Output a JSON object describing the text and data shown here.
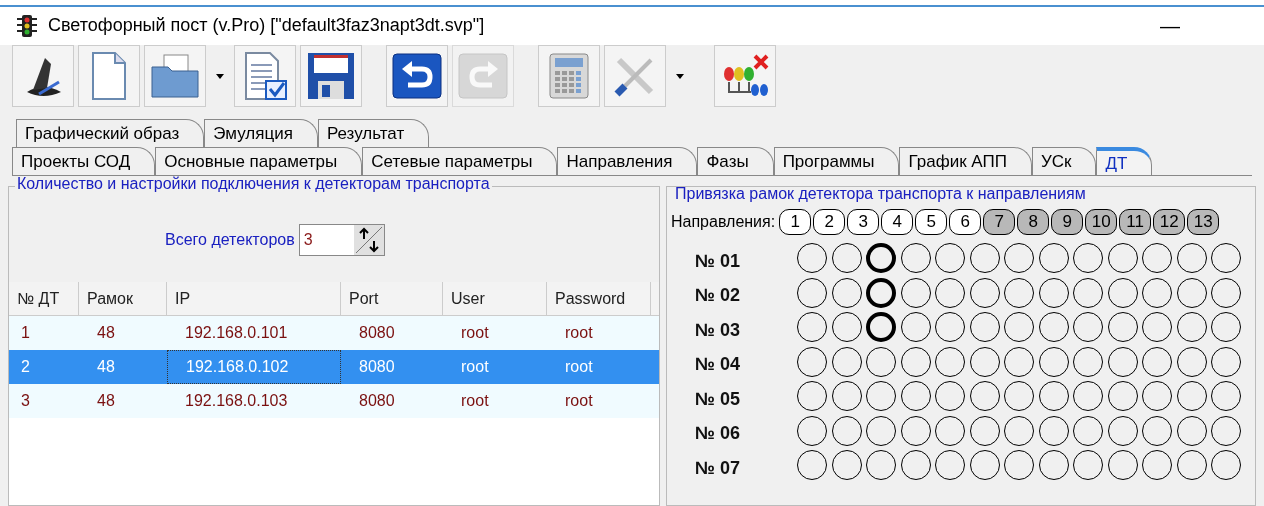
{
  "window": {
    "title": "Светофорный пост (v.Pro) [\"default3faz3napt3dt.svp\"]",
    "minimize": "—"
  },
  "toolbar": [
    {
      "kind": "wizard",
      "disabled": false
    },
    {
      "kind": "new",
      "disabled": false
    },
    {
      "kind": "open",
      "disabled": false,
      "dropdown": true
    },
    {
      "kind": "checklist",
      "disabled": false
    },
    {
      "kind": "save",
      "disabled": false
    },
    {
      "kind": "undo",
      "disabled": false
    },
    {
      "kind": "redo",
      "disabled": true
    },
    {
      "kind": "calculator",
      "disabled": false
    },
    {
      "kind": "tools",
      "disabled": false,
      "dropdown": true
    },
    {
      "kind": "lights",
      "disabled": false
    }
  ],
  "tabs_back": [
    {
      "label": "Графический образ",
      "selected": false
    },
    {
      "label": "Эмуляция",
      "selected": false
    },
    {
      "label": "Результат",
      "selected": false
    }
  ],
  "tabs": [
    {
      "label": "Проекты СОД",
      "selected": false
    },
    {
      "label": "Основные параметры",
      "selected": false
    },
    {
      "label": "Сетевые параметры",
      "selected": false
    },
    {
      "label": "Направления",
      "selected": false
    },
    {
      "label": "Фазы",
      "selected": false
    },
    {
      "label": "Программы",
      "selected": false
    },
    {
      "label": "График АПП",
      "selected": false
    },
    {
      "label": "УСк",
      "selected": false
    },
    {
      "label": "ДТ",
      "selected": true
    }
  ],
  "detectors": {
    "title": "Количество и настройки подключения к детекторам транспорта",
    "count_label": "Всего детекторов",
    "count_value": "3",
    "columns": [
      "№ ДТ",
      "Рамок",
      "IP",
      "Port",
      "User",
      "Password"
    ],
    "rows": [
      {
        "cells": [
          "1",
          "48",
          "192.168.0.101",
          "8080",
          "root",
          "root"
        ],
        "selected": false
      },
      {
        "cells": [
          "2",
          "48",
          "192.168.0.102",
          "8080",
          "root",
          "root"
        ],
        "selected": true
      },
      {
        "cells": [
          "3",
          "48",
          "192.168.0.103",
          "8080",
          "root",
          "root"
        ],
        "selected": false
      }
    ]
  },
  "binding": {
    "title": "Привязка рамок детектора транспорта к направлениям",
    "directions_label": "Направления:",
    "directions": [
      {
        "label": "1",
        "active": true
      },
      {
        "label": "2",
        "active": true
      },
      {
        "label": "3",
        "active": true
      },
      {
        "label": "4",
        "active": true
      },
      {
        "label": "5",
        "active": true
      },
      {
        "label": "6",
        "active": true
      },
      {
        "label": "7",
        "active": false
      },
      {
        "label": "8",
        "active": false
      },
      {
        "label": "9",
        "active": false
      },
      {
        "label": "10",
        "active": false
      },
      {
        "label": "11",
        "active": false
      },
      {
        "label": "12",
        "active": false
      },
      {
        "label": "13",
        "active": false
      }
    ],
    "frames": [
      {
        "label": "№ 01",
        "cells": [
          {
            "linked": false
          },
          {
            "linked": false
          },
          {
            "linked": true
          },
          {
            "linked": false
          },
          {
            "linked": false
          },
          {
            "linked": false
          },
          {
            "linked": false
          },
          {
            "linked": false
          },
          {
            "linked": false
          },
          {
            "linked": false
          },
          {
            "linked": false
          },
          {
            "linked": false
          },
          {
            "linked": false
          }
        ]
      },
      {
        "label": "№ 02",
        "cells": [
          {
            "linked": false
          },
          {
            "linked": false
          },
          {
            "linked": true
          },
          {
            "linked": false
          },
          {
            "linked": false
          },
          {
            "linked": false
          },
          {
            "linked": false
          },
          {
            "linked": false
          },
          {
            "linked": false
          },
          {
            "linked": false
          },
          {
            "linked": false
          },
          {
            "linked": false
          },
          {
            "linked": false
          }
        ]
      },
      {
        "label": "№ 03",
        "cells": [
          {
            "linked": false
          },
          {
            "linked": false
          },
          {
            "linked": true
          },
          {
            "linked": false
          },
          {
            "linked": false
          },
          {
            "linked": false
          },
          {
            "linked": false
          },
          {
            "linked": false
          },
          {
            "linked": false
          },
          {
            "linked": false
          },
          {
            "linked": false
          },
          {
            "linked": false
          },
          {
            "linked": false
          }
        ]
      },
      {
        "label": "№ 04",
        "cells": [
          {
            "linked": false
          },
          {
            "linked": false
          },
          {
            "linked": false
          },
          {
            "linked": false
          },
          {
            "linked": false
          },
          {
            "linked": false
          },
          {
            "linked": false
          },
          {
            "linked": false
          },
          {
            "linked": false
          },
          {
            "linked": false
          },
          {
            "linked": false
          },
          {
            "linked": false
          },
          {
            "linked": false
          }
        ]
      },
      {
        "label": "№ 05",
        "cells": [
          {
            "linked": false
          },
          {
            "linked": false
          },
          {
            "linked": false
          },
          {
            "linked": false
          },
          {
            "linked": false
          },
          {
            "linked": false
          },
          {
            "linked": false
          },
          {
            "linked": false
          },
          {
            "linked": false
          },
          {
            "linked": false
          },
          {
            "linked": false
          },
          {
            "linked": false
          },
          {
            "linked": false
          }
        ]
      },
      {
        "label": "№ 06",
        "cells": [
          {
            "linked": false
          },
          {
            "linked": false
          },
          {
            "linked": false
          },
          {
            "linked": false
          },
          {
            "linked": false
          },
          {
            "linked": false
          },
          {
            "linked": false
          },
          {
            "linked": false
          },
          {
            "linked": false
          },
          {
            "linked": false
          },
          {
            "linked": false
          },
          {
            "linked": false
          },
          {
            "linked": false
          }
        ]
      },
      {
        "label": "№ 07",
        "cells": [
          {
            "linked": false
          },
          {
            "linked": false
          },
          {
            "linked": false
          },
          {
            "linked": false
          },
          {
            "linked": false
          },
          {
            "linked": false
          },
          {
            "linked": false
          },
          {
            "linked": false
          },
          {
            "linked": false
          },
          {
            "linked": false
          },
          {
            "linked": false
          },
          {
            "linked": false
          },
          {
            "linked": false
          }
        ]
      }
    ]
  }
}
